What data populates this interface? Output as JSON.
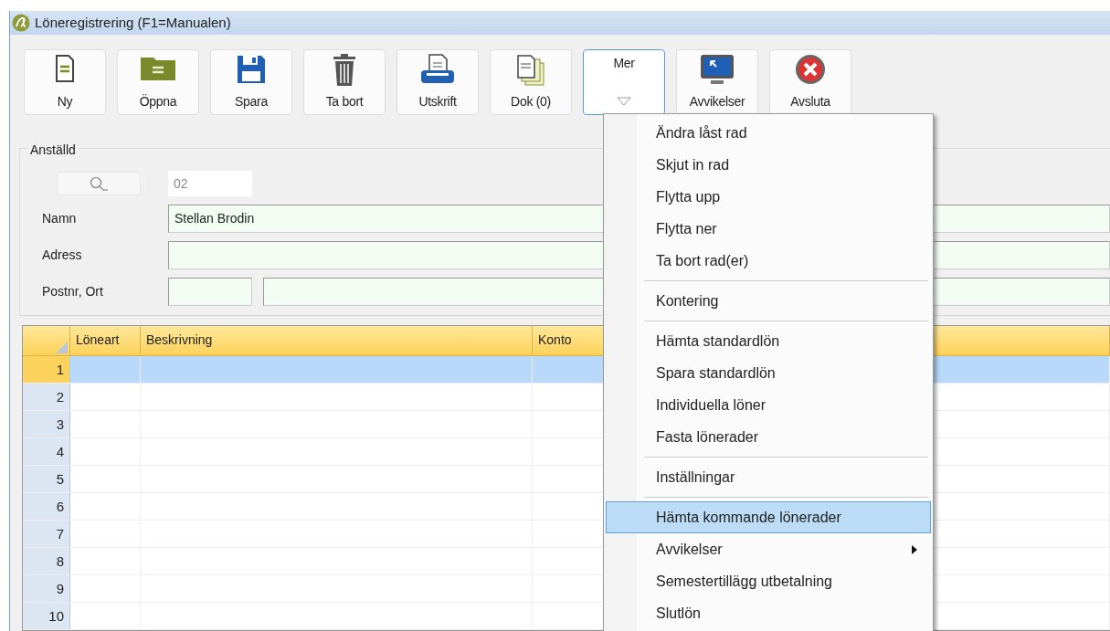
{
  "window": {
    "title": "Löneregistrering (F1=Manualen)"
  },
  "toolbar": [
    {
      "label": "Ny",
      "kind": "new",
      "pressed": false
    },
    {
      "label": "Öppna",
      "kind": "open",
      "pressed": false
    },
    {
      "label": "Spara",
      "kind": "save",
      "pressed": false
    },
    {
      "label": "Ta bort",
      "kind": "delete",
      "pressed": false
    },
    {
      "label": "Utskrift",
      "kind": "print",
      "pressed": false
    },
    {
      "label": "Dok (0)",
      "kind": "docs",
      "pressed": false
    },
    {
      "label": "Mer",
      "kind": "dropdown",
      "pressed": true
    },
    {
      "label": "Avvikelser",
      "kind": "monitor",
      "pressed": false
    },
    {
      "label": "Avsluta",
      "kind": "exit",
      "pressed": false
    }
  ],
  "employee": {
    "legend": "Anställd",
    "number": "02",
    "fields": [
      {
        "label": "Namn",
        "value": "Stellan Brodin",
        "split": false
      },
      {
        "label": "Adress",
        "split": false
      },
      {
        "label": "Postnr, Ort",
        "split": true
      }
    ]
  },
  "table": {
    "columns": [
      "Löneart",
      "Beskrivning",
      "Konto"
    ],
    "rows": [
      {
        "number": "1",
        "selected": true
      },
      {
        "number": "2",
        "selected": false
      },
      {
        "number": "3",
        "selected": false
      },
      {
        "number": "4",
        "selected": false
      },
      {
        "number": "5",
        "selected": false
      },
      {
        "number": "6",
        "selected": false
      },
      {
        "number": "7",
        "selected": false
      },
      {
        "number": "8",
        "selected": false
      },
      {
        "number": "9",
        "selected": false
      },
      {
        "number": "10",
        "selected": false
      }
    ]
  },
  "menu": {
    "groups": [
      [
        {
          "label": "Ändra låst rad",
          "selected": false,
          "submenu": false
        },
        {
          "label": "Skjut in rad",
          "selected": false,
          "submenu": false
        },
        {
          "label": "Flytta upp",
          "selected": false,
          "submenu": false
        },
        {
          "label": "Flytta ner",
          "selected": false,
          "submenu": false
        },
        {
          "label": "Ta bort rad(er)",
          "selected": false,
          "submenu": false
        }
      ],
      [
        {
          "label": "Kontering",
          "selected": false,
          "submenu": false
        }
      ],
      [
        {
          "label": "Hämta standardlön",
          "selected": false,
          "submenu": false
        },
        {
          "label": "Spara standardlön",
          "selected": false,
          "submenu": false
        },
        {
          "label": "Individuella löner",
          "selected": false,
          "submenu": false
        },
        {
          "label": "Fasta lönerader",
          "selected": false,
          "submenu": false
        }
      ],
      [
        {
          "label": "Inställningar",
          "selected": false,
          "submenu": false
        }
      ],
      [
        {
          "label": "Hämta kommande lönerader",
          "selected": true,
          "submenu": false
        },
        {
          "label": "Avvikelser",
          "selected": false,
          "submenu": true
        },
        {
          "label": "Semestertillägg utbetalning",
          "selected": false,
          "submenu": false
        },
        {
          "label": "Slutlön",
          "selected": false,
          "submenu": false
        }
      ]
    ]
  }
}
